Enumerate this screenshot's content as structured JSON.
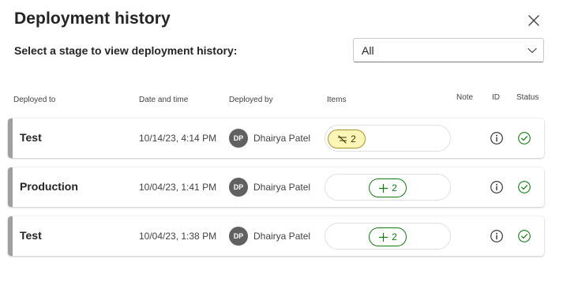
{
  "dialog": {
    "title": "Deployment history",
    "subtitle": "Select a stage to view deployment history:"
  },
  "stage_select": {
    "value": "All"
  },
  "columns": {
    "deployed_to": "Deployed to",
    "date_time": "Date and time",
    "deployed_by": "Deployed by",
    "items": "Items",
    "note": "Note",
    "id": "ID",
    "status": "Status"
  },
  "rows": [
    {
      "stage": "Test",
      "date": "10/14/23, 4:14 PM",
      "initials": "DP",
      "by": "Dhairya Patel",
      "pill_type": "changed",
      "pill_count": "2",
      "status": "success"
    },
    {
      "stage": "Production",
      "date": "10/04/23, 1:41 PM",
      "initials": "DP",
      "by": "Dhairya Patel",
      "pill_type": "added",
      "pill_count": "2",
      "status": "success"
    },
    {
      "stage": "Test",
      "date": "10/04/23, 1:38 PM",
      "initials": "DP",
      "by": "Dhairya Patel",
      "pill_type": "added",
      "pill_count": "2",
      "status": "success"
    }
  ],
  "colors": {
    "accent_bar": "#a19f9d",
    "success": "#107c10",
    "changed_bg": "#fdf6b7",
    "avatar_bg": "#616161"
  }
}
